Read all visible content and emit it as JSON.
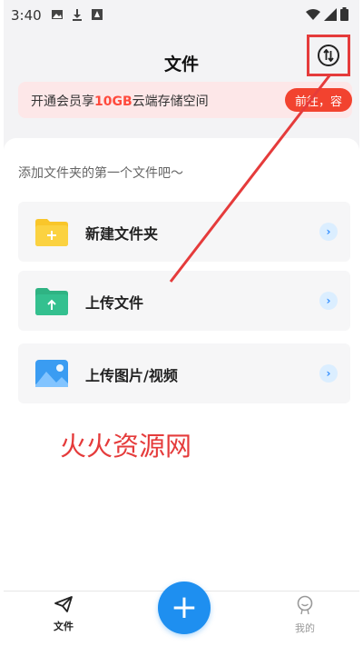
{
  "status_bar": {
    "time": "3:40",
    "icons": [
      "image-icon",
      "download-icon",
      "app-icon"
    ],
    "right_icons": [
      "wifi-icon",
      "signal-icon",
      "battery-icon"
    ]
  },
  "header": {
    "title": "文件",
    "switch_icon": "swap-arrows-icon"
  },
  "banner": {
    "text_before": "开通会员享",
    "highlight": "10GB",
    "text_after": "云端存储空间",
    "button": "前往，容"
  },
  "panel": {
    "hint": "添加文件夹的第一个文件吧～",
    "actions": [
      {
        "label": "新建文件夹",
        "icon": "new-folder-icon"
      },
      {
        "label": "上传文件",
        "icon": "upload-file-icon"
      },
      {
        "label": "上传图片/视频",
        "icon": "upload-image-icon"
      }
    ]
  },
  "watermark": "火火资源网",
  "tabbar": {
    "tabs": [
      {
        "label": "文件",
        "icon": "paper-plane-icon",
        "active": true
      },
      {
        "label": "我的",
        "icon": "profile-icon",
        "active": false
      }
    ],
    "fab_icon": "plus-icon",
    "fab_label": "+"
  },
  "colors": {
    "accent": "#1e8ff0",
    "banner_bg": "#fde7e8",
    "banner_button": "#f2432f",
    "annotation": "#e53b3b",
    "folder_yellow": "#f9c62a",
    "folder_green": "#34c08f",
    "image_blue": "#3a9cf2"
  }
}
